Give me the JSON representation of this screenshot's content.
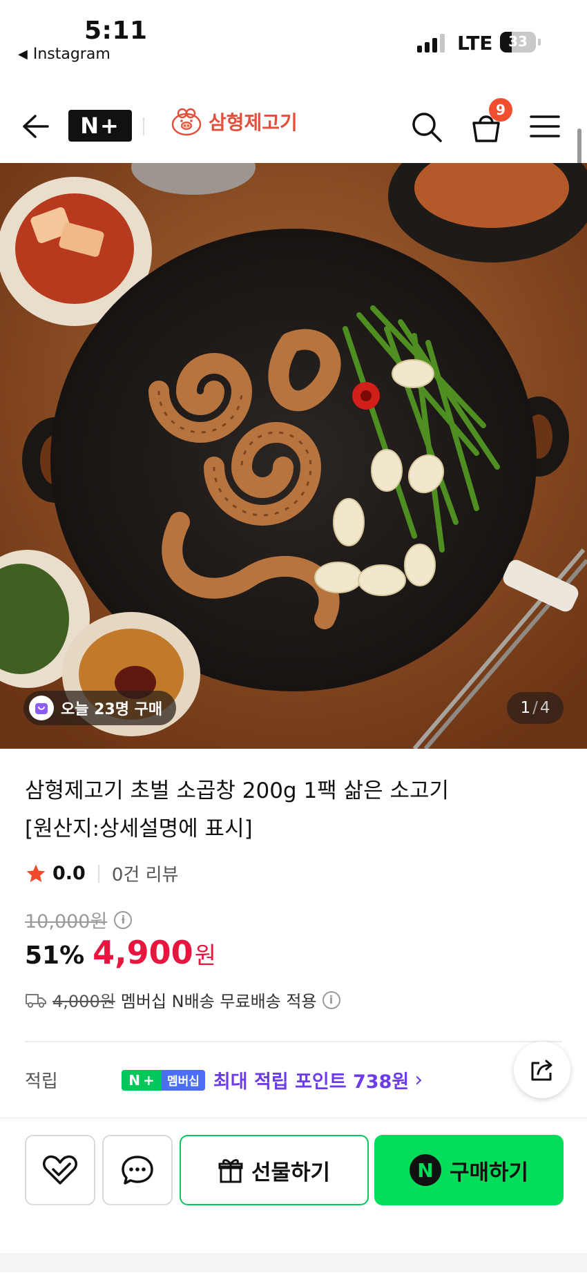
{
  "status_bar": {
    "time": "5:11",
    "back_app": "Instagram",
    "network": "LTE",
    "battery": "33",
    "battery_level": 0.33
  },
  "header": {
    "logo_text": "N+",
    "brand_name": "삼형제고기",
    "cart_count": "9"
  },
  "hero": {
    "today_buyers": "오늘 23명 구매",
    "page_current": "1",
    "page_sep": "/",
    "page_total": "4"
  },
  "product": {
    "title_line1": "삼형제고기 초벌 소곱창 200g 1팩 삶은 소고기",
    "title_line2": "[원산지:상세설명에 표시]",
    "rating_score": "0.0",
    "review_count": "0건 리뷰",
    "original_price": "10,000원",
    "discount": "51%",
    "price": "4,900",
    "currency": "원",
    "shipping_old": "4,000원",
    "shipping_text": "멤버십 N배송 무료배송 적용"
  },
  "points": {
    "label": "적립",
    "badge_n": "N",
    "badge_plus": "+",
    "badge_member": "멤버십",
    "text": "최대 적립 포인트 738원"
  },
  "bottom_bar": {
    "gift_label": "선물하기",
    "buy_label": "구매하기",
    "buy_logo": "N"
  },
  "colors": {
    "brand_red": "#e0503b",
    "price_red": "#e8163f",
    "naver_green": "#03de5a",
    "points_purple": "#6c3ce8",
    "badge_orange": "#f04e2e"
  }
}
